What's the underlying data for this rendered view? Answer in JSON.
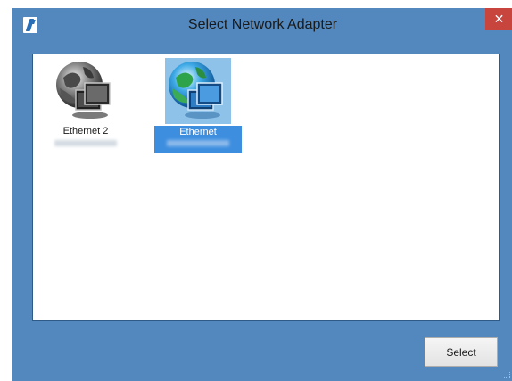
{
  "window": {
    "title": "Select Network Adapter",
    "close_glyph": "✕"
  },
  "adapters": [
    {
      "name": "Ethernet 2",
      "icon": "network-globe-icon",
      "selected": false
    },
    {
      "name": "Ethernet",
      "icon": "network-globe-icon",
      "selected": true
    }
  ],
  "buttons": {
    "select_label": "Select"
  },
  "colors": {
    "window_chrome": "#5288bd",
    "close_button": "#c7453d",
    "selection": "#3e8ee0"
  }
}
